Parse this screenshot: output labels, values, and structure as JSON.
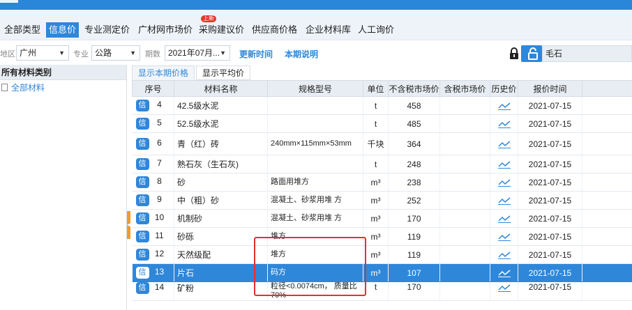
{
  "tabs": [
    {
      "label": "全部类型",
      "active": false
    },
    {
      "label": "信息价",
      "active": true
    },
    {
      "label": "专业测定价",
      "active": false
    },
    {
      "label": "广材网市场价",
      "active": false
    },
    {
      "label": "采购建议价",
      "active": false
    },
    {
      "label": "供应商价格",
      "active": false
    },
    {
      "label": "企业材料库",
      "active": false
    },
    {
      "label": "人工询价",
      "active": false
    }
  ],
  "new_badge": "上新",
  "filters": {
    "region_label": "地区",
    "region_value": "广州",
    "specialty_label": "专业",
    "specialty_value": "公路",
    "period_label": "期数",
    "period_value": "2021年07月...",
    "update_time_link": "更新时间",
    "period_note_link": "本期说明",
    "search_value": "毛石"
  },
  "left_panel": {
    "header": "所有材料类别",
    "nodes": [
      "全部材料"
    ]
  },
  "subtabs": [
    "显示本期价格",
    "显示平均价"
  ],
  "columns": [
    "序号",
    "材料名称",
    "规格型号",
    "单位",
    "不含税市场价",
    "含税市场价",
    "历史价",
    "报价时间"
  ],
  "info_badge": "信",
  "colors": {
    "accent": "#2f87d9",
    "highlight_box": "#e52f2f",
    "badge_red": "#e8342a"
  },
  "rows": [
    {
      "no": "4",
      "name": "42.5级水泥",
      "spec": "",
      "unit": "t",
      "price": "458",
      "tax_price": "",
      "date": "2021-07-15"
    },
    {
      "no": "5",
      "name": "52.5级水泥",
      "spec": "",
      "unit": "t",
      "price": "485",
      "tax_price": "",
      "date": "2021-07-15"
    },
    {
      "no": "6",
      "name": "青（红）砖",
      "spec": "240mm×115mm×53mm",
      "unit": "千块",
      "price": "364",
      "tax_price": "",
      "date": "2021-07-15"
    },
    {
      "no": "7",
      "name": "熟石灰（生石灰)",
      "spec": "",
      "unit": "t",
      "price": "248",
      "tax_price": "",
      "date": "2021-07-15"
    },
    {
      "no": "8",
      "name": "砂",
      "spec": "路面用堆方",
      "unit": "m³",
      "price": "238",
      "tax_price": "",
      "date": "2021-07-15"
    },
    {
      "no": "9",
      "name": "中（粗）砂",
      "spec": "混凝土、砂浆用堆 方",
      "unit": "m³",
      "price": "252",
      "tax_price": "",
      "date": "2021-07-15"
    },
    {
      "no": "10",
      "name": "机制砂",
      "spec": "混凝土、砂浆用堆 方",
      "unit": "m³",
      "price": "170",
      "tax_price": "",
      "date": "2021-07-15"
    },
    {
      "no": "11",
      "name": "砂砾",
      "spec": "堆方",
      "unit": "m³",
      "price": "119",
      "tax_price": "",
      "date": "2021-07-15"
    },
    {
      "no": "12",
      "name": "天然级配",
      "spec": "堆方",
      "unit": "m³",
      "price": "119",
      "tax_price": "",
      "date": "2021-07-15"
    },
    {
      "no": "13",
      "name": "片石",
      "spec": "码方",
      "unit": "m³",
      "price": "107",
      "tax_price": "",
      "date": "2021-07-15"
    },
    {
      "no": "14",
      "name": "矿粉",
      "spec": "粒径<0.0074cm， 质量比 70%",
      "unit": "t",
      "price": "170",
      "tax_price": "",
      "date": "2021-07-15"
    }
  ],
  "selected_row_index": 9
}
